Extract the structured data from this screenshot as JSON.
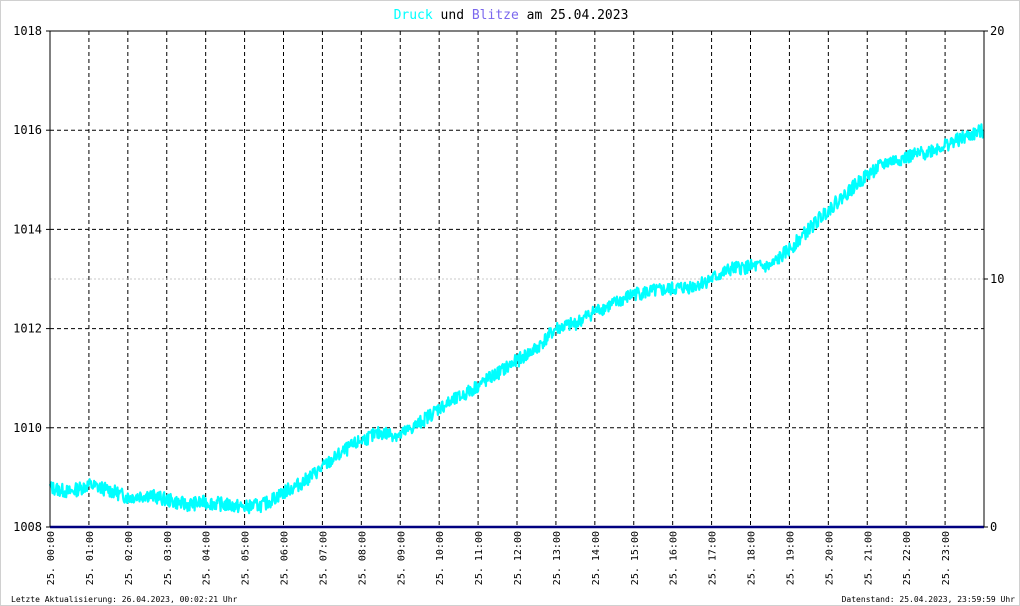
{
  "title": {
    "part1": "Druck",
    "part2": " und ",
    "part3": "Blitze",
    "part4": " am 25.04.2023"
  },
  "colors": {
    "druck": "#00ffff",
    "blitze": "#7b68ee",
    "baseline": "#000080",
    "grid": "#000000",
    "grid_minor": "#c8c8c8"
  },
  "footer": {
    "left": "Letzte Aktualisierung: 26.04.2023, 00:02:21 Uhr",
    "right": "Datenstand: 25.04.2023, 23:59:59 Uhr"
  },
  "chart_data": {
    "type": "line",
    "title": "Druck und Blitze am 25.04.2023",
    "grid": true,
    "y_left": {
      "ticks": [
        "1008",
        "1010",
        "1012",
        "1014",
        "1016",
        "1018"
      ],
      "range": [
        1008,
        1018
      ]
    },
    "y_right": {
      "ticks": [
        "0",
        "10",
        "20"
      ],
      "range": [
        0,
        20
      ]
    },
    "x_ticks": [
      "25. 00:00",
      "25. 01:00",
      "25. 02:00",
      "25. 03:00",
      "25. 04:00",
      "25. 05:00",
      "25. 06:00",
      "25. 07:00",
      "25. 08:00",
      "25. 09:00",
      "25. 10:00",
      "25. 11:00",
      "25. 12:00",
      "25. 13:00",
      "25. 14:00",
      "25. 15:00",
      "25. 16:00",
      "25. 17:00",
      "25. 18:00",
      "25. 19:00",
      "25. 20:00",
      "25. 21:00",
      "25. 22:00",
      "25. 23:00"
    ],
    "series": [
      {
        "name": "Druck",
        "axis": "left",
        "x_hours": [
          0,
          0.5,
          1,
          1.5,
          2,
          2.5,
          3,
          3.5,
          4,
          4.5,
          5,
          5.5,
          6,
          6.5,
          7,
          7.5,
          8,
          8.5,
          9,
          9.5,
          10,
          10.5,
          11,
          11.5,
          12,
          12.5,
          13,
          13.5,
          14,
          14.5,
          15,
          15.5,
          16,
          16.5,
          17,
          17.5,
          18,
          18.5,
          19,
          19.5,
          20,
          20.5,
          21,
          21.5,
          22,
          22.5,
          23,
          23.5,
          24
        ],
        "values": [
          1008.8,
          1008.7,
          1008.85,
          1008.75,
          1008.6,
          1008.65,
          1008.55,
          1008.45,
          1008.5,
          1008.45,
          1008.4,
          1008.45,
          1008.7,
          1008.9,
          1009.2,
          1009.5,
          1009.75,
          1009.9,
          1009.85,
          1010.1,
          1010.4,
          1010.6,
          1010.85,
          1011.1,
          1011.35,
          1011.6,
          1012.0,
          1012.1,
          1012.35,
          1012.5,
          1012.7,
          1012.75,
          1012.8,
          1012.85,
          1013.0,
          1013.2,
          1013.25,
          1013.25,
          1013.6,
          1014.0,
          1014.4,
          1014.75,
          1015.1,
          1015.35,
          1015.45,
          1015.55,
          1015.7,
          1015.85,
          1016.0
        ]
      },
      {
        "name": "Blitze",
        "axis": "right",
        "x_hours": [
          0,
          24
        ],
        "values": [
          0,
          0
        ]
      }
    ]
  }
}
